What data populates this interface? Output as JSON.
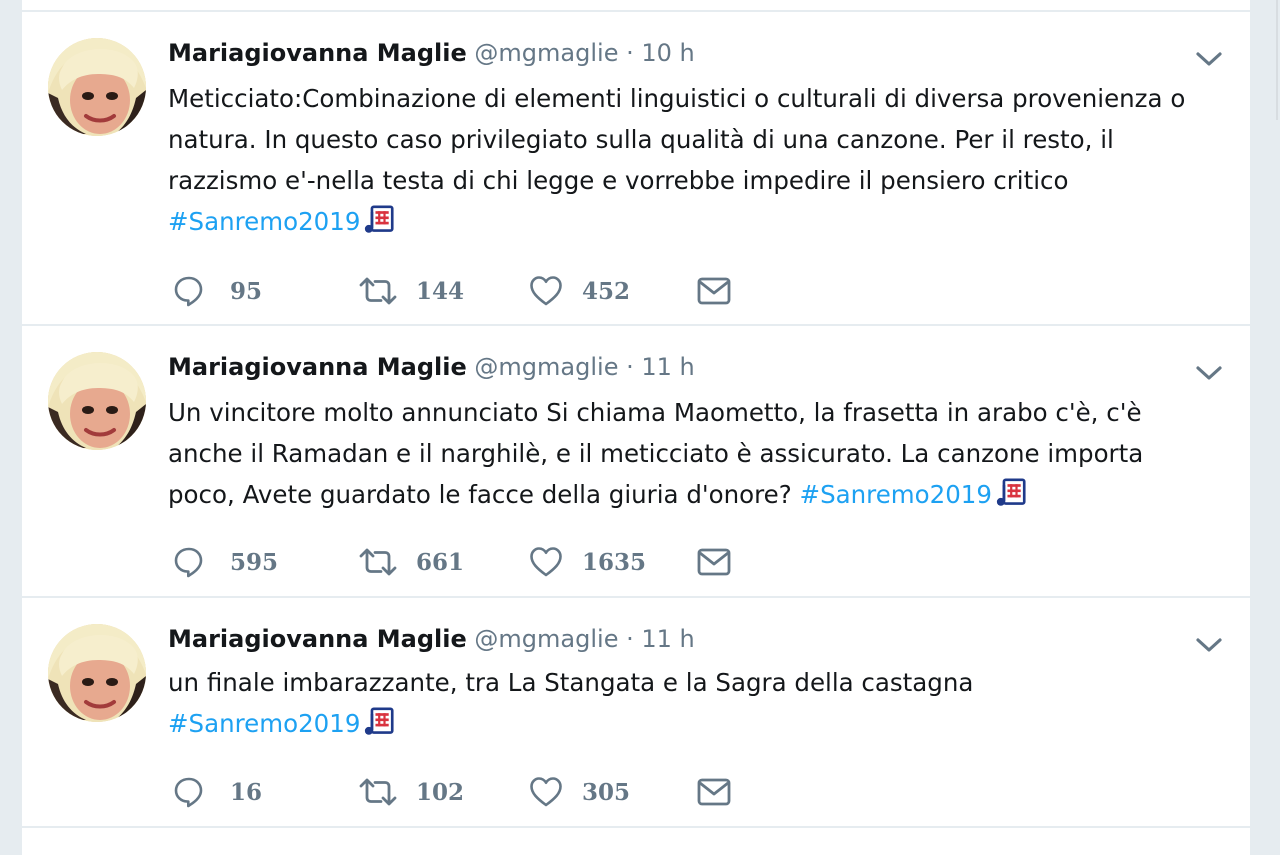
{
  "tweets": [
    {
      "name": "Mariagiovanna Maglie",
      "handle": "@mgmaglie",
      "separator": "·",
      "time": "10 h",
      "lines": [
        "Meticciato:Combinazione di elementi linguistici o culturali di diversa provenienza o",
        "natura. In questo caso privilegiato sulla qualità di una canzone. Per il resto, il",
        "razzismo e'-nella testa  di chi legge e vorrebbe impedire il pensiero critico"
      ],
      "hashtag_prefix": "",
      "hashtag": "#Sanremo2019",
      "emoji_icon": "musical-score-icon",
      "replies": "95",
      "retweets": "144",
      "likes": "452"
    },
    {
      "name": "Mariagiovanna Maglie",
      "handle": "@mgmaglie",
      "separator": "·",
      "time": "11 h",
      "lines": [
        "Un vincitore molto annunciato Si chiama Maometto, la frasetta in arabo c'è, c'è",
        "anche il Ramadan e il narghilè, e il meticciato è assicurato. La canzone  importa"
      ],
      "hashtag_prefix": "poco, Avete guardato le facce della giuria d'onore? ",
      "hashtag": "#Sanremo2019",
      "emoji_icon": "musical-score-icon",
      "replies": "595",
      "retweets": "661",
      "likes": "1635"
    },
    {
      "name": "Mariagiovanna Maglie",
      "handle": "@mgmaglie",
      "separator": "·",
      "time": "11 h",
      "lines": [
        "un finale imbarazzante, tra La Stangata e la Sagra della castagna"
      ],
      "hashtag_prefix": "",
      "hashtag": "#Sanremo2019",
      "emoji_icon": "musical-score-icon",
      "replies": "16",
      "retweets": "102",
      "likes": "305"
    }
  ],
  "colors": {
    "link": "#1da1f2",
    "muted": "#657786",
    "background": "#e6ecf0"
  }
}
